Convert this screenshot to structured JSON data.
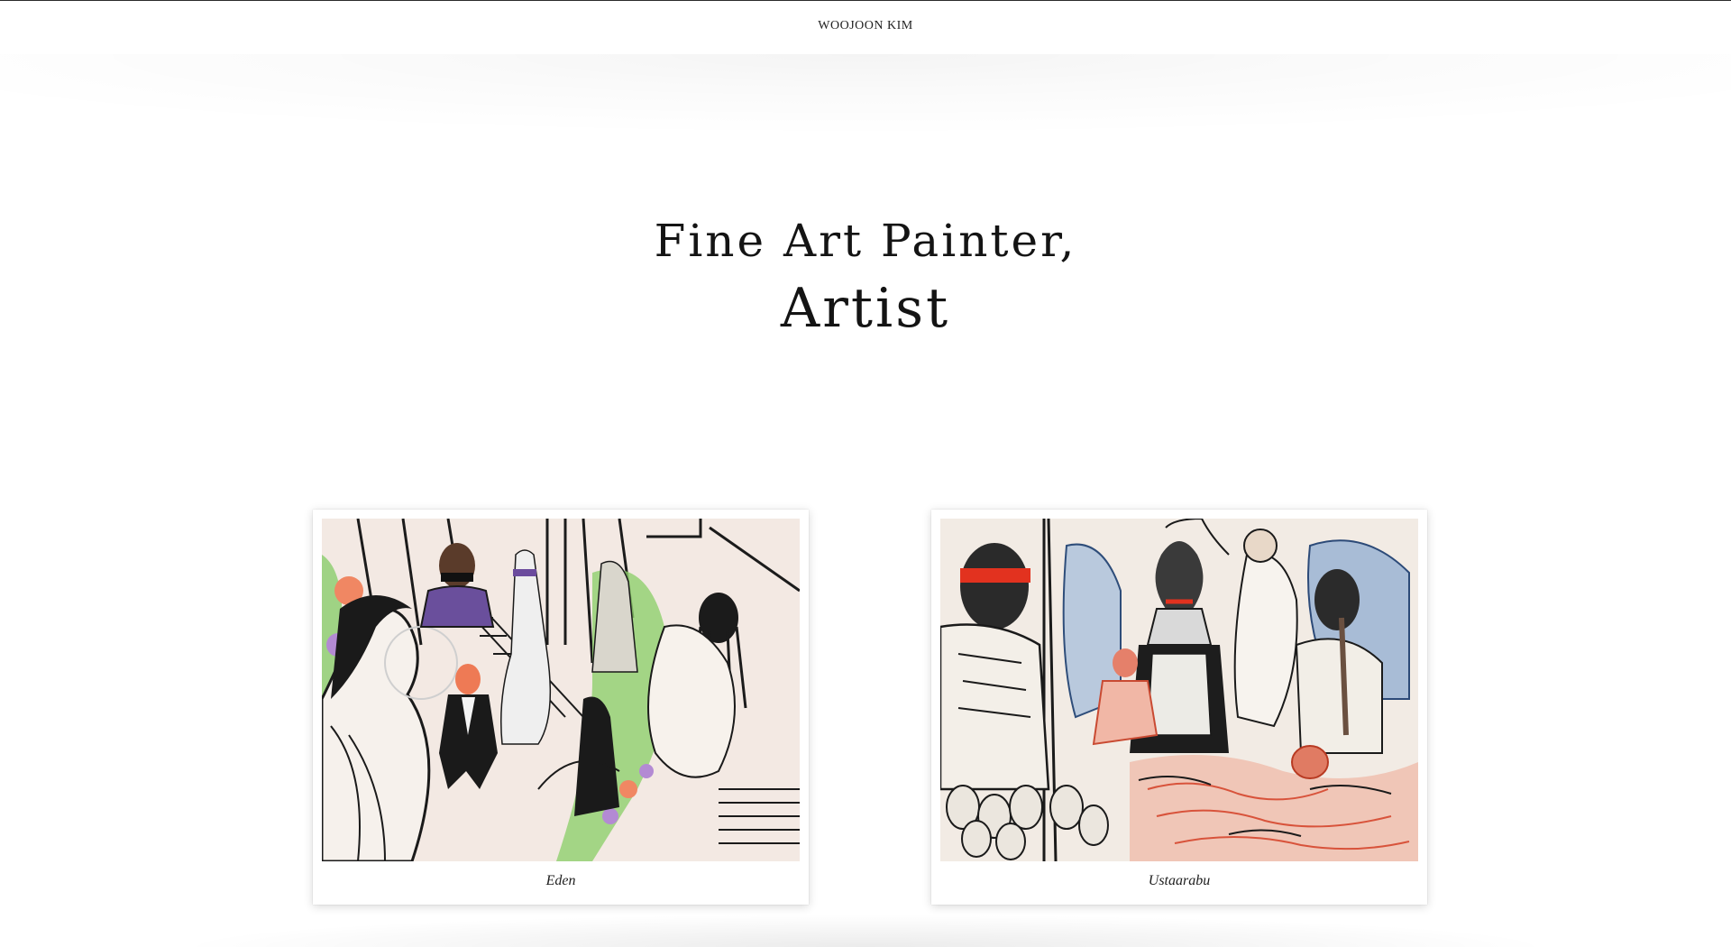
{
  "header": {
    "brand": "WOOJOON KIM"
  },
  "hero": {
    "line1": "Fine Art Painter,",
    "line2": "Artist"
  },
  "gallery": {
    "items": [
      {
        "title": "Eden"
      },
      {
        "title": "Ustaarabu"
      }
    ]
  }
}
